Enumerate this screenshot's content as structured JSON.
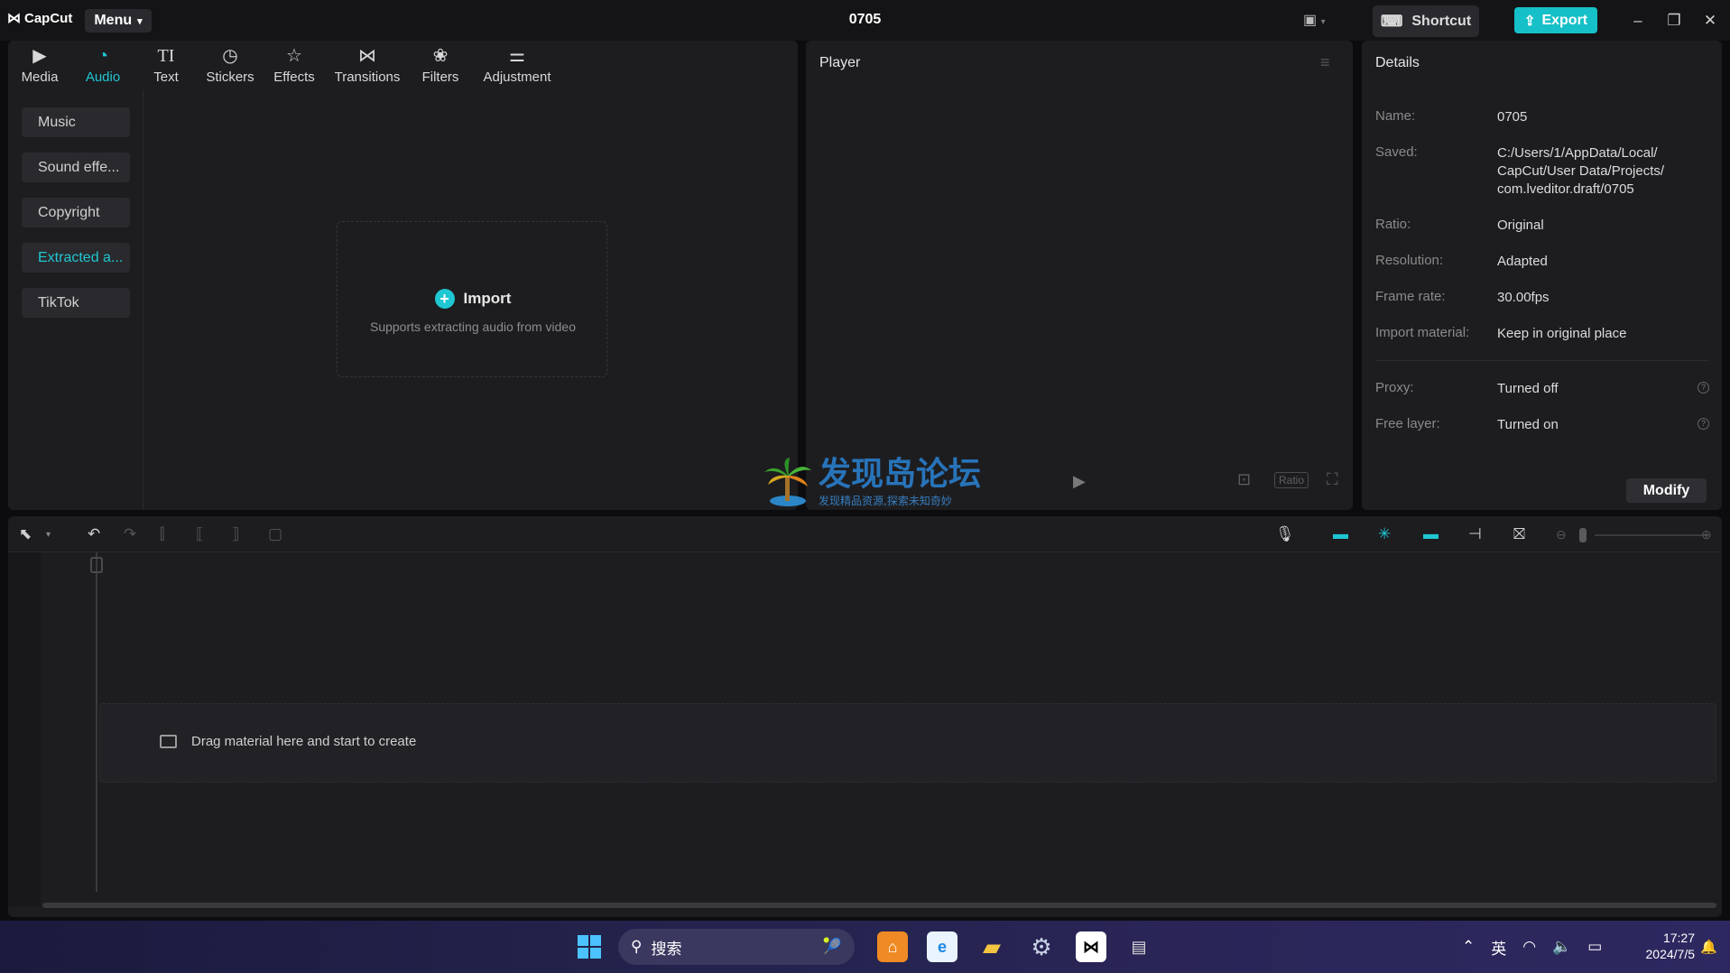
{
  "window": {
    "app_name": "CapCut",
    "menu_label": "Menu",
    "project_title": "0705",
    "shortcut_label": "Shortcut",
    "export_label": "Export"
  },
  "colors": {
    "accent": "#1fc7d2",
    "export_bg": "#16c0c8",
    "panel_bg": "#1d1d20"
  },
  "tabs": [
    {
      "label": "Media",
      "icon": "media-icon"
    },
    {
      "label": "Audio",
      "icon": "audio-icon",
      "active": true
    },
    {
      "label": "Text",
      "icon": "text-icon"
    },
    {
      "label": "Stickers",
      "icon": "stickers-icon"
    },
    {
      "label": "Effects",
      "icon": "effects-icon"
    },
    {
      "label": "Transitions",
      "icon": "transitions-icon"
    },
    {
      "label": "Filters",
      "icon": "filters-icon"
    },
    {
      "label": "Adjustment",
      "icon": "adjustment-icon"
    }
  ],
  "audio_categories": [
    "Music",
    "Sound effe...",
    "Copyright",
    "Extracted a...",
    "TikTok"
  ],
  "import": {
    "label": "Import",
    "hint": "Supports extracting audio from video"
  },
  "player": {
    "title": "Player",
    "ratio_label": "Ratio"
  },
  "watermark": {
    "line1": "发现岛论坛",
    "line2": "发现精品资源,探索未知奇妙"
  },
  "details": {
    "title": "Details",
    "rows": [
      {
        "label": "Name:",
        "value": "0705"
      },
      {
        "label": "Saved:",
        "value": "C:/Users/1/AppData/Local/ CapCut/User Data/Projects/ com.lveditor.draft/0705"
      },
      {
        "label": "Ratio:",
        "value": "Original"
      },
      {
        "label": "Resolution:",
        "value": "Adapted"
      },
      {
        "label": "Frame rate:",
        "value": "30.00fps"
      },
      {
        "label": "Import material:",
        "value": "Keep in original place"
      },
      {
        "label": "Proxy:",
        "value": "Turned off"
      },
      {
        "label": "Free layer:",
        "value": "Turned on"
      }
    ],
    "modify_label": "Modify"
  },
  "timeline": {
    "drop_hint": "Drag material here and start to create"
  },
  "taskbar": {
    "search_placeholder": "搜索",
    "ime": "英",
    "time": "17:27",
    "date": "2024/7/5"
  }
}
